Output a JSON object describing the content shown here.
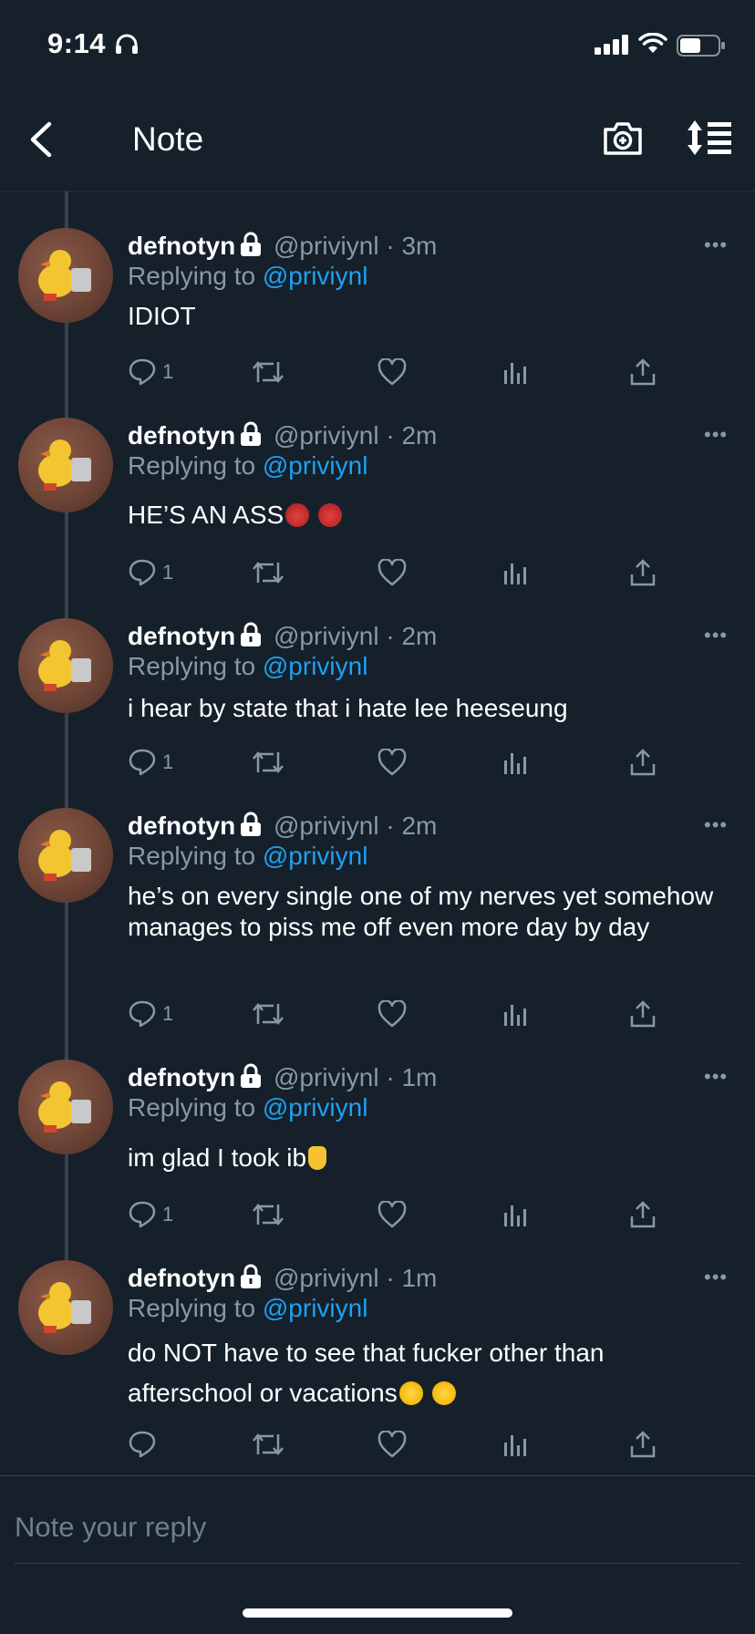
{
  "status_bar": {
    "time": "9:14"
  },
  "nav": {
    "title": "Note"
  },
  "replying_label": "Replying to",
  "tweets": [
    {
      "name": "defnotyn",
      "handle": "@priviynl",
      "time": "3m",
      "reply_to": "@priviynl",
      "text": "IDIOT",
      "reply_count": "1"
    },
    {
      "name": "defnotyn",
      "handle": "@priviynl",
      "time": "2m",
      "reply_to": "@priviynl",
      "text": "HE’S AN ASS",
      "reply_count": "1"
    },
    {
      "name": "defnotyn",
      "handle": "@priviynl",
      "time": "2m",
      "reply_to": "@priviynl",
      "text": "i hear by state that i hate lee heeseung",
      "reply_count": "1"
    },
    {
      "name": "defnotyn",
      "handle": "@priviynl",
      "time": "2m",
      "reply_to": "@priviynl",
      "text": "he’s on every single one of my nerves yet somehow manages to piss me off even more day by day",
      "reply_count": "1"
    },
    {
      "name": "defnotyn",
      "handle": "@priviynl",
      "time": "1m",
      "reply_to": "@priviynl",
      "text": "im glad I took ib",
      "reply_count": "1"
    },
    {
      "name": "defnotyn",
      "handle": "@priviynl",
      "time": "1m",
      "reply_to": "@priviynl",
      "text": "do NOT have to see that fucker other than afterschool or vacations",
      "reply_count": ""
    }
  ],
  "composer": {
    "placeholder": "Note your reply"
  },
  "colors": {
    "background": "#15202b",
    "accent": "#1da1f2",
    "muted": "#8899a6"
  }
}
